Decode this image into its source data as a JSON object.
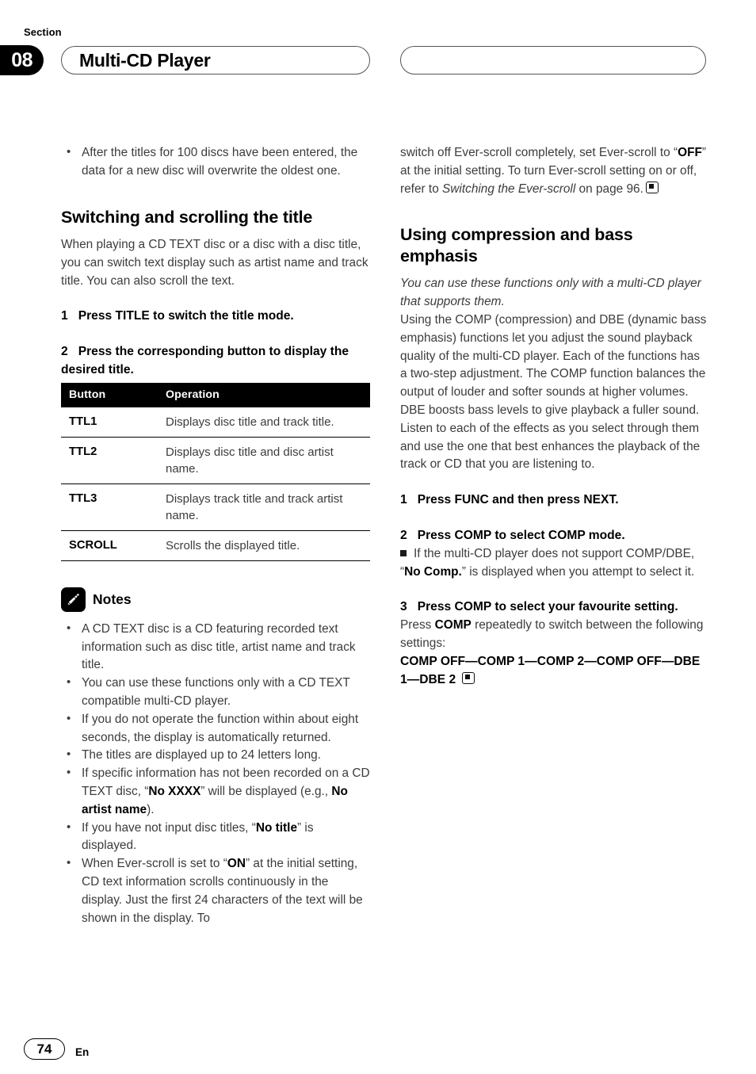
{
  "header": {
    "section_label": "Section",
    "section_number": "08",
    "chapter_title": "Multi-CD Player",
    "right_pill_title": ""
  },
  "left_column": {
    "top_bullets": [
      "After the titles for 100 discs have been entered, the data for a new disc will overwrite the oldest one."
    ],
    "heading": "Switching and scrolling the title",
    "intro": "When playing a CD TEXT disc or a disc with a disc title, you can switch text display such as artist name and track title. You can also scroll the text.",
    "steps": [
      {
        "num": "1",
        "text": "Press TITLE to switch the title mode."
      },
      {
        "num": "2",
        "text": "Press the corresponding button to display the desired title."
      }
    ],
    "table": {
      "columns": [
        "Button",
        "Operation"
      ],
      "rows": [
        {
          "button": "TTL1",
          "operation": "Displays disc title and track title."
        },
        {
          "button": "TTL2",
          "operation": "Displays disc title and disc artist name."
        },
        {
          "button": "TTL3",
          "operation": "Displays track title and track artist name."
        },
        {
          "button": "SCROLL",
          "operation": "Scrolls the displayed title."
        }
      ]
    },
    "notes_title": "Notes",
    "notes_icon": "pencil-icon",
    "notes": [
      "A CD TEXT disc is a CD featuring recorded text information such as disc title, artist name and track title.",
      "You can use these functions only with a CD TEXT compatible multi-CD player.",
      "If you do not operate the function within about eight seconds, the display is automatically returned.",
      "The titles are displayed up to 24 letters long."
    ],
    "note_no_xxxx_pre": "If specific information has not been recorded on a CD TEXT disc, “",
    "note_no_xxxx_bold": "No XXXX",
    "note_no_xxxx_mid": "” will be displayed (e.g., ",
    "note_no_xxxx_bold2": "No artist name",
    "note_no_xxxx_post": ").",
    "note_no_title_pre": "If you have not input disc titles, “",
    "note_no_title_bold": "No title",
    "note_no_title_post": "” is displayed.",
    "note_everscroll_pre": "When Ever-scroll is set to “",
    "note_everscroll_bold": "ON",
    "note_everscroll_post": "” at the initial setting, CD text information scrolls continuously in the display. Just the first 24 characters of the text will be shown in the display. To"
  },
  "right_column": {
    "continued_pre": "switch off Ever-scroll completely, set Ever-scroll to “",
    "continued_bold": "OFF",
    "continued_mid": "” at the initial setting. To turn Ever-scroll setting on or off, refer to ",
    "continued_italic": "Switching the Ever-scroll",
    "continued_post": " on page 96.",
    "heading": "Using compression and bass emphasis",
    "italic_intro": "You can use these functions only with a multi-CD player that supports them.",
    "body": "Using the COMP (compression) and DBE (dynamic bass emphasis) functions let you adjust the sound playback quality of the multi-CD player. Each of the functions has a two-step adjustment. The COMP function balances the output of louder and softer sounds at higher volumes. DBE boosts bass levels to give playback a fuller sound. Listen to each of the effects as you select through them and use the one that best enhances the playback of the track or CD that you are listening to.",
    "step1": {
      "num": "1",
      "text": "Press FUNC and then press NEXT."
    },
    "step2": {
      "num": "2",
      "text": "Press COMP to select COMP mode."
    },
    "step2_note_pre": "If the multi-CD player does not support COMP/DBE, “",
    "step2_note_bold": "No Comp.",
    "step2_note_post": "” is displayed when you attempt to select it.",
    "step3": {
      "num": "3",
      "text": "Press COMP to select your favourite setting."
    },
    "step3_body_pre": "Press ",
    "step3_body_bold": "COMP",
    "step3_body_post": " repeatedly to switch between the following settings:",
    "settings_chain": "COMP OFF—COMP 1—COMP 2—COMP OFF—DBE 1—DBE 2"
  },
  "footer": {
    "page_number": "74",
    "language": "En"
  },
  "colors": {
    "ink": "#231f20",
    "body_text": "#3c3c3c",
    "accent_black": "#000000",
    "page_background": "#ffffff"
  }
}
